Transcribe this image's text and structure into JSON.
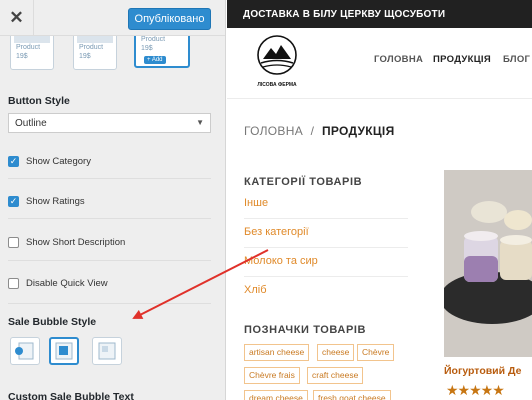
{
  "panel": {
    "publish_label": "Опубліковано",
    "thumbnails": [
      {
        "product": "Product",
        "price": "19$"
      },
      {
        "product": "Product",
        "price": "19$"
      },
      {
        "product": "Product",
        "price": "19$",
        "add": "+ Add"
      }
    ],
    "button_style": {
      "title": "Button Style",
      "value": "Outline"
    },
    "checkboxes": [
      {
        "label": "Show Category",
        "checked": true
      },
      {
        "label": "Show Ratings",
        "checked": true
      },
      {
        "label": "Show Short Description",
        "checked": false
      },
      {
        "label": "Disable Quick View",
        "checked": false
      }
    ],
    "sale_bubble_title": "Sale Bubble Style",
    "custom_sale_title": "Custom Sale Bubble Text"
  },
  "site": {
    "topbar": "ДОСТАВКА В БІЛУ ЦЕРКВУ ЩОСУБОТИ",
    "logo_text": "ЛІСОВА ФЕРМА",
    "nav": [
      "ГОЛОВНА",
      "ПРОДУКЦІЯ",
      "БЛОГ"
    ],
    "breadcrumb": {
      "home": "ГОЛОВНА",
      "separator": "/",
      "current": "ПРОДУКЦІЯ"
    },
    "categories_title": "КАТЕГОРІЇ ТОВАРІВ",
    "categories": [
      "Інше",
      "Без категорії",
      "Молоко та сир",
      "Хліб"
    ],
    "tags_title": "ПОЗНАЧКИ ТОВАРІВ",
    "tags": [
      "artisan cheese",
      "cheese",
      "Chèvre",
      "Chèvre frais",
      "craft cheese",
      "dream cheese",
      "fresh goat cheese"
    ],
    "product": {
      "title": "Йогуртовий Де",
      "rating": "★★★★★"
    }
  },
  "colors": {
    "accent": "#2e8ccf",
    "link": "#e08a2a",
    "arrow": "#e0312a"
  }
}
